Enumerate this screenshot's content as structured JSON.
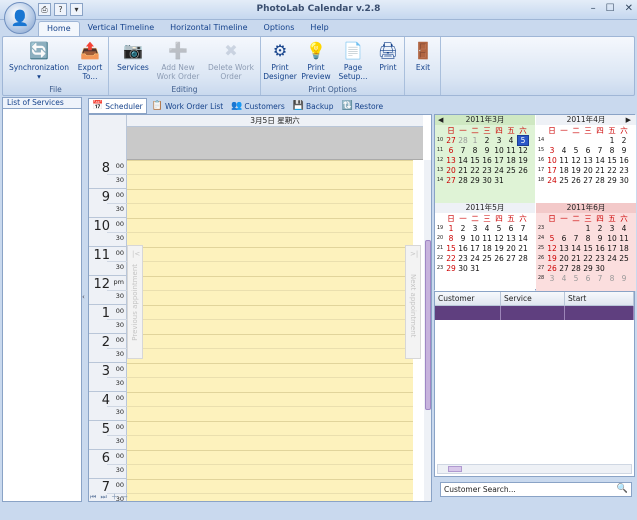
{
  "window": {
    "title": "PhotoLab Calendar v.2.8",
    "controls": [
      "–",
      "☐",
      "✕"
    ]
  },
  "tabs": [
    {
      "label": "Home",
      "active": true
    },
    {
      "label": "Vertical Timeline"
    },
    {
      "label": "Horizontal Timeline"
    },
    {
      "label": "Options"
    },
    {
      "label": "Help"
    }
  ],
  "ribbon": {
    "file": {
      "label": "File",
      "buttons": [
        {
          "label": "Synchronization",
          "icon": "sync-icon"
        },
        {
          "label": "Export To...",
          "icon": "export-icon"
        }
      ]
    },
    "editing": {
      "label": "Editing",
      "buttons": [
        {
          "label": "Services",
          "icon": "camera-icon"
        },
        {
          "label": "Add New Work Order",
          "icon": "add-icon",
          "disabled": true
        },
        {
          "label": "Delete Work Order",
          "icon": "delete-icon",
          "disabled": true
        }
      ]
    },
    "print": {
      "label": "Print Options",
      "buttons": [
        {
          "label": "Print Designer",
          "icon": "gear-icon"
        },
        {
          "label": "Print Preview",
          "icon": "bulb-icon"
        },
        {
          "label": "Page Setup...",
          "icon": "pages-icon"
        },
        {
          "label": "Print",
          "icon": "printer-icon"
        }
      ]
    },
    "exit": {
      "label": "Exit",
      "icon": "exit-icon"
    }
  },
  "left": {
    "title": "List of Services"
  },
  "viewtabs": [
    {
      "label": "Scheduler",
      "active": true
    },
    {
      "label": "Work Order List"
    },
    {
      "label": "Customers"
    },
    {
      "label": "Backup"
    },
    {
      "label": "Restore"
    }
  ],
  "scheduler": {
    "date_header": "3月5日 星期六",
    "hours": [
      {
        "n": "8",
        "m": "00"
      },
      {
        "n": "9",
        "m": "00"
      },
      {
        "n": "10",
        "m": "00"
      },
      {
        "n": "11",
        "m": "00"
      },
      {
        "n": "12",
        "m": "pm"
      },
      {
        "n": "1",
        "m": "00"
      },
      {
        "n": "2",
        "m": "00"
      },
      {
        "n": "3",
        "m": "00"
      },
      {
        "n": "4",
        "m": "00"
      },
      {
        "n": "5",
        "m": "00"
      },
      {
        "n": "6",
        "m": "00"
      },
      {
        "n": "7",
        "m": "00"
      }
    ],
    "half": "30",
    "prev": "Previous appointment",
    "next": "Next appointment"
  },
  "calendar": {
    "weekdays": [
      "日",
      "一",
      "二",
      "三",
      "四",
      "五",
      "六"
    ],
    "months": [
      {
        "title": "2011年3月",
        "rows": [
          [
            "10",
            "27",
            "28",
            "1",
            "2",
            "3",
            "4",
            "5"
          ],
          [
            "11",
            "6",
            "7",
            "8",
            "9",
            "10",
            "11",
            "12"
          ],
          [
            "12",
            "13",
            "14",
            "15",
            "16",
            "17",
            "18",
            "19"
          ],
          [
            "13",
            "20",
            "21",
            "22",
            "23",
            "24",
            "25",
            "26"
          ],
          [
            "14",
            "27",
            "28",
            "29",
            "30",
            "31",
            "",
            ""
          ]
        ],
        "selected": "5"
      },
      {
        "title": "2011年4月",
        "rows": [
          [
            "14",
            "",
            "",
            "",
            "",
            "",
            "1",
            "2"
          ],
          [
            "15",
            "3",
            "4",
            "5",
            "6",
            "7",
            "8",
            "9"
          ],
          [
            "16",
            "10",
            "11",
            "12",
            "13",
            "14",
            "15",
            "16"
          ],
          [
            "17",
            "17",
            "18",
            "19",
            "20",
            "21",
            "22",
            "23"
          ],
          [
            "18",
            "24",
            "25",
            "26",
            "27",
            "28",
            "29",
            "30"
          ]
        ]
      },
      {
        "title": "2011年5月",
        "rows": [
          [
            "19",
            "1",
            "2",
            "3",
            "4",
            "5",
            "6",
            "7"
          ],
          [
            "20",
            "8",
            "9",
            "10",
            "11",
            "12",
            "13",
            "14"
          ],
          [
            "21",
            "15",
            "16",
            "17",
            "18",
            "19",
            "20",
            "21"
          ],
          [
            "22",
            "22",
            "23",
            "24",
            "25",
            "26",
            "27",
            "28"
          ],
          [
            "23",
            "29",
            "30",
            "31",
            "",
            "",
            "",
            ""
          ]
        ]
      },
      {
        "title": "2011年6月",
        "rows": [
          [
            "23",
            "",
            "",
            "",
            "1",
            "2",
            "3",
            "4"
          ],
          [
            "24",
            "5",
            "6",
            "7",
            "8",
            "9",
            "10",
            "11"
          ],
          [
            "25",
            "12",
            "13",
            "14",
            "15",
            "16",
            "17",
            "18"
          ],
          [
            "26",
            "19",
            "20",
            "21",
            "22",
            "23",
            "24",
            "25"
          ],
          [
            "27",
            "26",
            "27",
            "28",
            "29",
            "30",
            "",
            ""
          ],
          [
            "28",
            "3",
            "4",
            "5",
            "6",
            "7",
            "8",
            "9"
          ]
        ]
      }
    ]
  },
  "grid": {
    "columns": [
      "Customer",
      "Service",
      "Start"
    ]
  },
  "search": {
    "placeholder": "Customer Search..."
  },
  "colors": {
    "accent": "#2b58c7",
    "workday": "#fdf2bd",
    "row_selected": "#5f3f7f",
    "march_bg": "#dff3d6",
    "june_bg": "#fbdede"
  }
}
